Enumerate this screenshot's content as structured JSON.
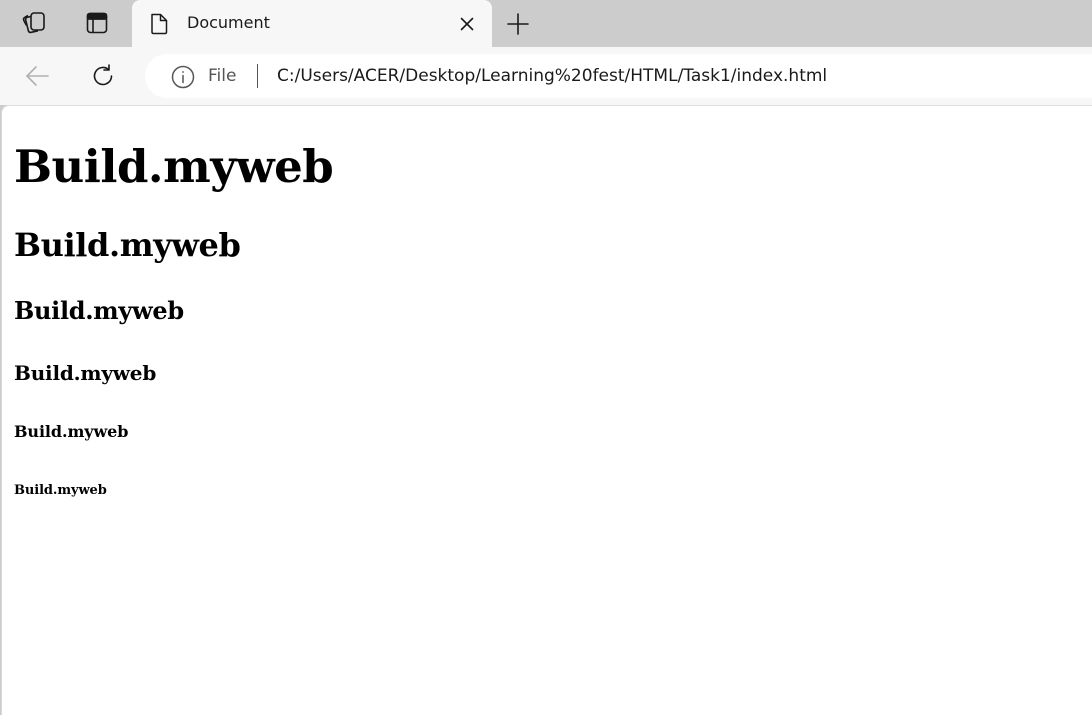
{
  "browser": {
    "tab": {
      "title": "Document"
    },
    "address": {
      "scheme_label": "File",
      "url": "C:/Users/ACER/Desktop/Learning%20fest/HTML/Task1/index.html"
    }
  },
  "page": {
    "headings": {
      "h1": "Build.myweb",
      "h2": "Build.myweb",
      "h3": "Build.myweb",
      "h4": "Build.myweb",
      "h5": "Build.myweb",
      "h6": "Build.myweb"
    }
  },
  "icons": [
    "workspaces-icon",
    "vertical-tabs-icon",
    "document-icon",
    "close-icon",
    "plus-icon",
    "back-arrow-icon",
    "refresh-icon",
    "info-icon"
  ],
  "colors": {
    "tabstrip": "#cccccc",
    "toolbar": "#f7f7f7",
    "page": "#ffffff"
  }
}
